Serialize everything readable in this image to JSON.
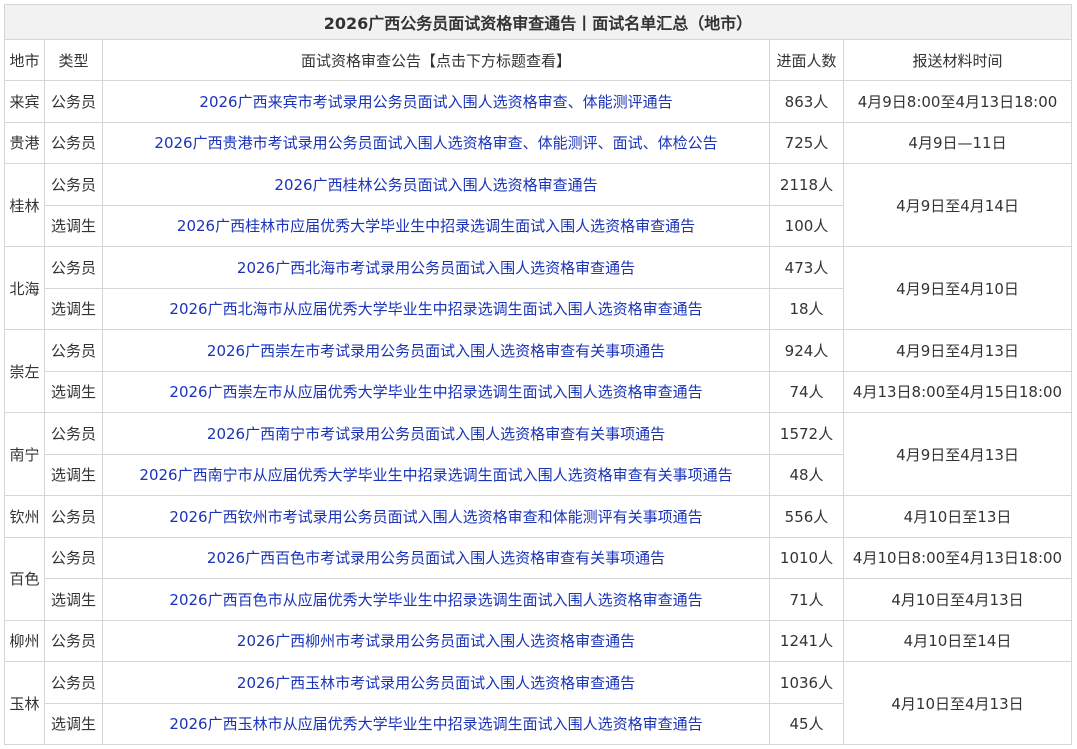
{
  "title": "2026广西公务员面试资格审查通告丨面试名单汇总（地市）",
  "columns": [
    "地市",
    "类型",
    "面试资格审查公告【点击下方标题查看】",
    "进面人数",
    "报送材料时间"
  ],
  "cities": [
    {
      "name": "来宾",
      "rows": [
        {
          "type": "公务员",
          "notice": "2026广西来宾市考试录用公务员面试入围人选资格审查、体能测评通告",
          "count": "863人",
          "time": "4月9日8:00至4月13日18:00"
        }
      ]
    },
    {
      "name": "贵港",
      "rows": [
        {
          "type": "公务员",
          "notice": "2026广西贵港市考试录用公务员面试入围人选资格审查、体能测评、面试、体检公告",
          "count": "725人",
          "time": "4月9日—11日"
        }
      ]
    },
    {
      "name": "桂林",
      "time": "4月9日至4月14日",
      "rows": [
        {
          "type": "公务员",
          "notice": "2026广西桂林公务员面试入围人选资格审查通告",
          "count": "2118人"
        },
        {
          "type": "选调生",
          "notice": "2026广西桂林市应届优秀大学毕业生中招录选调生面试入围人选资格审查通告",
          "count": "100人"
        }
      ]
    },
    {
      "name": "北海",
      "time": "4月9日至4月10日",
      "rows": [
        {
          "type": "公务员",
          "notice": "2026广西北海市考试录用公务员面试入围人选资格审查通告",
          "count": "473人"
        },
        {
          "type": "选调生",
          "notice": "2026广西北海市从应届优秀大学毕业生中招录选调生面试入围人选资格审查通告",
          "count": "18人"
        }
      ]
    },
    {
      "name": "崇左",
      "rows": [
        {
          "type": "公务员",
          "notice": "2026广西崇左市考试录用公务员面试入围人选资格审查有关事项通告",
          "count": "924人",
          "time": "4月9日至4月13日"
        },
        {
          "type": "选调生",
          "notice": "2026广西崇左市从应届优秀大学毕业生中招录选调生面试入围人选资格审查通告",
          "count": "74人",
          "time": "4月13日8:00至4月15日18:00"
        }
      ]
    },
    {
      "name": "南宁",
      "time": "4月9日至4月13日",
      "rows": [
        {
          "type": "公务员",
          "notice": "2026广西南宁市考试录用公务员面试入围人选资格审查有关事项通告",
          "count": "1572人"
        },
        {
          "type": "选调生",
          "notice": "2026广西南宁市从应届优秀大学毕业生中招录选调生面试入围人选资格审查有关事项通告",
          "count": "48人"
        }
      ]
    },
    {
      "name": "钦州",
      "rows": [
        {
          "type": "公务员",
          "notice": "2026广西钦州市考试录用公务员面试入围人选资格审查和体能测评有关事项通告",
          "count": "556人",
          "time": "4月10日至13日"
        }
      ]
    },
    {
      "name": "百色",
      "rows": [
        {
          "type": "公务员",
          "notice": "2026广西百色市考试录用公务员面试入围人选资格审查有关事项通告",
          "count": "1010人",
          "time": "4月10日8:00至4月13日18:00"
        },
        {
          "type": "选调生",
          "notice": "2026广西百色市从应届优秀大学毕业生中招录选调生面试入围人选资格审查通告",
          "count": "71人",
          "time": "4月10日至4月13日"
        }
      ]
    },
    {
      "name": "柳州",
      "rows": [
        {
          "type": "公务员",
          "notice": "2026广西柳州市考试录用公务员面试入围人选资格审查通告",
          "count": "1241人",
          "time": "4月10日至14日"
        }
      ]
    },
    {
      "name": "玉林",
      "time": "4月10日至4月13日",
      "rows": [
        {
          "type": "公务员",
          "notice": "2026广西玉林市考试录用公务员面试入围人选资格审查通告",
          "count": "1036人"
        },
        {
          "type": "选调生",
          "notice": "2026广西玉林市从应届优秀大学毕业生中招录选调生面试入围人选资格审查通告",
          "count": "45人"
        }
      ]
    }
  ]
}
